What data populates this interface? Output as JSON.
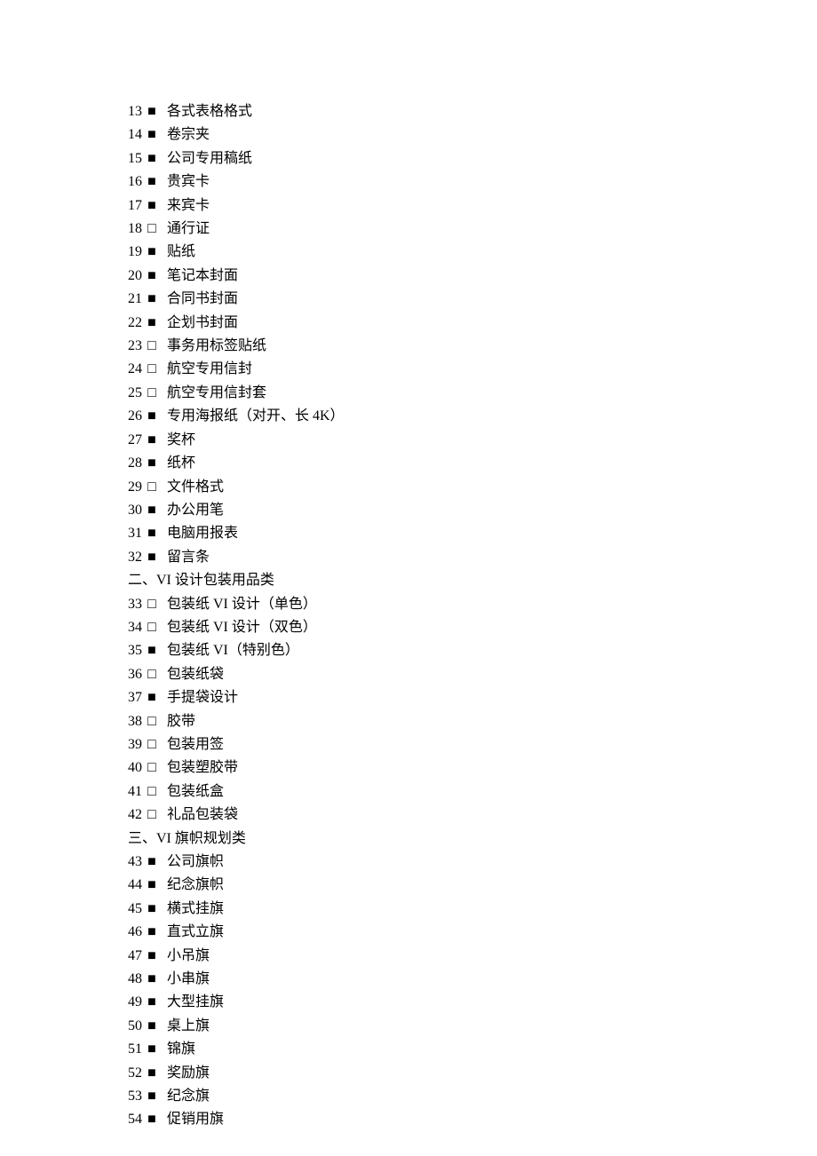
{
  "items": [
    {
      "type": "item",
      "num": "13",
      "marker": "filled",
      "label": "各式表格格式"
    },
    {
      "type": "item",
      "num": "14",
      "marker": "filled",
      "label": "卷宗夹"
    },
    {
      "type": "item",
      "num": "15",
      "marker": "filled",
      "label": "公司专用稿纸"
    },
    {
      "type": "item",
      "num": "16",
      "marker": "filled",
      "label": "贵宾卡"
    },
    {
      "type": "item",
      "num": "17",
      "marker": "filled",
      "label": "来宾卡"
    },
    {
      "type": "item",
      "num": "18",
      "marker": "empty",
      "label": "通行证"
    },
    {
      "type": "item",
      "num": "19",
      "marker": "filled",
      "label": "贴纸"
    },
    {
      "type": "item",
      "num": "20",
      "marker": "filled",
      "label": "笔记本封面"
    },
    {
      "type": "item",
      "num": "21",
      "marker": "filled",
      "label": "合同书封面"
    },
    {
      "type": "item",
      "num": "22",
      "marker": "filled",
      "label": "企划书封面"
    },
    {
      "type": "item",
      "num": "23",
      "marker": "empty",
      "label": "事务用标签贴纸"
    },
    {
      "type": "item",
      "num": "24",
      "marker": "empty",
      "label": "航空专用信封"
    },
    {
      "type": "item",
      "num": "25",
      "marker": "empty",
      "label": "航空专用信封套"
    },
    {
      "type": "item",
      "num": "26",
      "marker": "filled",
      "label": "专用海报纸（对开、长 4K）"
    },
    {
      "type": "item",
      "num": "27",
      "marker": "filled",
      "label": "奖杯"
    },
    {
      "type": "item",
      "num": "28",
      "marker": "filled",
      "label": "纸杯"
    },
    {
      "type": "item",
      "num": "29",
      "marker": "empty",
      "label": "文件格式"
    },
    {
      "type": "item",
      "num": "30",
      "marker": "filled",
      "label": "办公用笔"
    },
    {
      "type": "item",
      "num": "31",
      "marker": "filled",
      "label": "电脑用报表"
    },
    {
      "type": "item",
      "num": "32",
      "marker": "filled",
      "label": "留言条"
    },
    {
      "type": "heading",
      "text": "二、VI 设计包装用品类"
    },
    {
      "type": "item",
      "num": "33",
      "marker": "empty",
      "label": "包装纸 VI 设计（单色）"
    },
    {
      "type": "item",
      "num": "34",
      "marker": "empty",
      "label": "包装纸 VI 设计（双色）"
    },
    {
      "type": "item",
      "num": "35",
      "marker": "filled",
      "label": "包装纸 VI（特别色）"
    },
    {
      "type": "item",
      "num": "36",
      "marker": "empty",
      "label": "包装纸袋"
    },
    {
      "type": "item",
      "num": "37",
      "marker": "filled",
      "label": "手提袋设计"
    },
    {
      "type": "item",
      "num": "38",
      "marker": "empty",
      "label": "胶带"
    },
    {
      "type": "item",
      "num": "39",
      "marker": "empty",
      "label": "包装用签"
    },
    {
      "type": "item",
      "num": "40",
      "marker": "empty",
      "label": "包装塑胶带"
    },
    {
      "type": "item",
      "num": "41",
      "marker": "empty",
      "label": "包装纸盒"
    },
    {
      "type": "item",
      "num": "42",
      "marker": "empty",
      "label": "礼品包装袋"
    },
    {
      "type": "heading",
      "text": "三、VI 旗帜规划类"
    },
    {
      "type": "item",
      "num": "43",
      "marker": "filled",
      "label": "公司旗帜"
    },
    {
      "type": "item",
      "num": "44",
      "marker": "filled",
      "label": "纪念旗帜"
    },
    {
      "type": "item",
      "num": "45",
      "marker": "filled",
      "label": "横式挂旗"
    },
    {
      "type": "item",
      "num": "46",
      "marker": "filled",
      "label": "直式立旗"
    },
    {
      "type": "item",
      "num": "47",
      "marker": "filled",
      "label": "小吊旗"
    },
    {
      "type": "item",
      "num": "48",
      "marker": "filled",
      "label": "小串旗"
    },
    {
      "type": "item",
      "num": "49",
      "marker": "filled",
      "label": "大型挂旗"
    },
    {
      "type": "item",
      "num": "50",
      "marker": "filled",
      "label": "桌上旗"
    },
    {
      "type": "item",
      "num": "51",
      "marker": "filled",
      "label": "锦旗"
    },
    {
      "type": "item",
      "num": "52",
      "marker": "filled",
      "label": "奖励旗"
    },
    {
      "type": "item",
      "num": "53",
      "marker": "filled",
      "label": "纪念旗"
    },
    {
      "type": "item",
      "num": "54",
      "marker": "filled",
      "label": "促销用旗"
    }
  ]
}
